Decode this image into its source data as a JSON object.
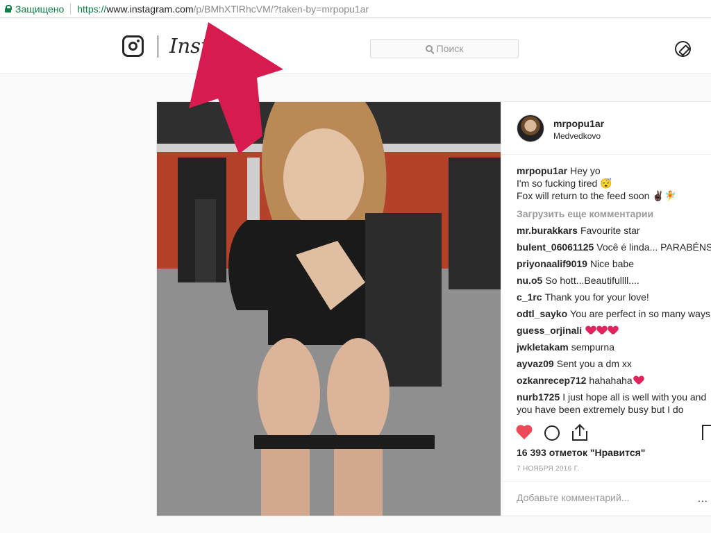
{
  "browser": {
    "secure_label": "Защищено",
    "url_scheme": "https://",
    "url_host": "www.instagram.com",
    "url_path": "/p/BMhXTlRhcVM/?taken-by=mrpopu1ar"
  },
  "header": {
    "wordmark": "Insta",
    "search_placeholder": "Поиск"
  },
  "post": {
    "username": "mrpopu1ar",
    "location": "Medvedkovo",
    "caption": {
      "user": "mrpopu1ar",
      "lines": [
        "Hey yo",
        "I'm so fucking tired 😴",
        "Fox will return to the feed soon ✌🏿🧚"
      ]
    },
    "load_more": "Загрузить еще комментарии",
    "comments": [
      {
        "user": "mr.burakkars",
        "text": "Favourite star"
      },
      {
        "user": "bulent_06061125",
        "text": "Você é linda... PARABÉNS"
      },
      {
        "user": "priyonaalif9019",
        "text": "Nice babe"
      },
      {
        "user": "nu.o5",
        "text": "So hott...Beautifullll...."
      },
      {
        "user": "c_1rc",
        "text": "Thank you for your love!"
      },
      {
        "user": "odtl_sayko",
        "text": "You are perfect in so many ways"
      },
      {
        "user": "guess_orjinali",
        "text": ""
      },
      {
        "user": "jwkletakam",
        "text": "sempurna"
      },
      {
        "user": "ayvaz09",
        "text": "Sent you a dm xx"
      },
      {
        "user": "ozkanrecep712",
        "text": "hahahaha"
      },
      {
        "user": "nurb1725",
        "text": "I just hope all is well with you and you have been extremely busy but I do"
      }
    ],
    "likes": "16 393 отметок \"Нравится\"",
    "date": "7 НОЯБРЯ 2016 Г.",
    "add_comment_placeholder": "Добавьте комментарий...",
    "more_label": "..."
  },
  "colors": {
    "accent_red": "#e0245e",
    "arrow": "#d81b4f",
    "secure_green": "#0b8043"
  }
}
